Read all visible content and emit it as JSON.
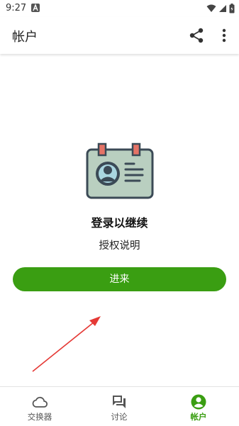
{
  "status_bar": {
    "time": "9:27"
  },
  "app_bar": {
    "title": "帐户",
    "share_icon": "share-icon",
    "more_icon": "more-vert-icon"
  },
  "content": {
    "illustration": "id-card-icon",
    "login_title": "登录以继续",
    "auth_description": "授权说明",
    "enter_button": "进来"
  },
  "bottom_nav": {
    "items": [
      {
        "label": "交换器",
        "icon": "cloud-icon",
        "active": false
      },
      {
        "label": "讨论",
        "icon": "chat-icon",
        "active": false
      },
      {
        "label": "帐户",
        "icon": "account-icon",
        "active": true
      }
    ]
  },
  "colors": {
    "accent": "#3a9e12",
    "annotation_arrow": "#e53935",
    "card_fill": "#b9cfc0",
    "card_border": "#3b4a56",
    "card_tabs": "#e57366"
  }
}
